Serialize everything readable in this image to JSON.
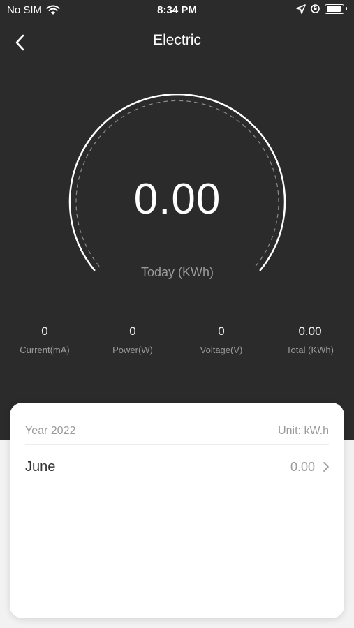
{
  "status_bar": {
    "carrier": "No SIM",
    "time": "8:34 PM"
  },
  "nav": {
    "title": "Electric",
    "back_icon": "chevron-left-icon"
  },
  "gauge": {
    "value": "0.00",
    "label": "Today (KWh)",
    "level": 0
  },
  "stats": [
    {
      "value": "0",
      "label": "Current(mA)"
    },
    {
      "value": "0",
      "label": "Power(W)"
    },
    {
      "value": "0",
      "label": "Voltage(V)"
    },
    {
      "value": "0.00",
      "label": "Total (KWh)"
    }
  ],
  "card": {
    "year": "Year 2022",
    "unit": "Unit: kW.h",
    "months": [
      {
        "name": "June",
        "value": "0.00"
      }
    ]
  },
  "colors": {
    "background": "#2b2b2b",
    "card": "#ffffff",
    "muted_text": "#9a9a9a"
  }
}
